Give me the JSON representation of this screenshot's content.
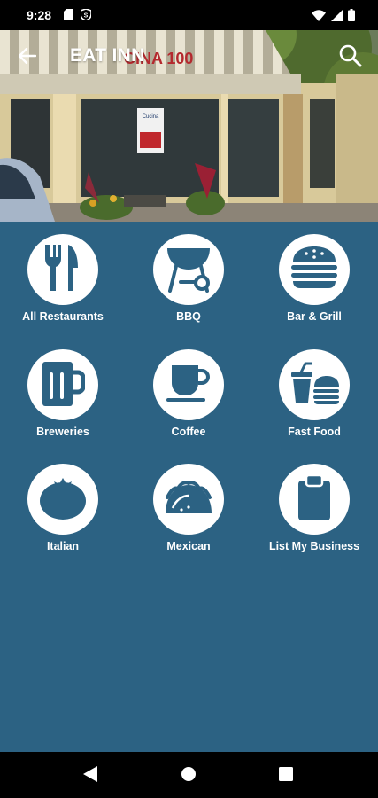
{
  "status_bar": {
    "time": "9:28",
    "left_icons": [
      "sd-card-icon",
      "shield-icon"
    ],
    "right_icons": [
      "wifi-icon",
      "signal-icon",
      "battery-icon"
    ]
  },
  "app_bar": {
    "title": "EAT INN",
    "back_icon": "arrow-back-icon",
    "search_icon": "search-icon"
  },
  "hero": {
    "storefront_sign": "CINA 100",
    "window_sign": "Cucina"
  },
  "colors": {
    "background": "#2c6283",
    "icon_fill": "#2c6283",
    "circle": "#ffffff"
  },
  "categories": [
    {
      "label": "All Restaurants",
      "icon": "fork-knife-icon"
    },
    {
      "label": "BBQ",
      "icon": "grill-icon"
    },
    {
      "label": "Bar & Grill",
      "icon": "burger-icon"
    },
    {
      "label": "Breweries",
      "icon": "beer-mug-icon"
    },
    {
      "label": "Coffee",
      "icon": "coffee-cup-icon"
    },
    {
      "label": "Fast Food",
      "icon": "fast-food-icon"
    },
    {
      "label": "Italian",
      "icon": "tomato-icon"
    },
    {
      "label": "Mexican",
      "icon": "taco-icon"
    },
    {
      "label": "List My Business",
      "icon": "clipboard-icon"
    }
  ],
  "nav_bar": {
    "buttons": [
      "back-nav-icon",
      "home-nav-icon",
      "recents-nav-icon"
    ]
  }
}
